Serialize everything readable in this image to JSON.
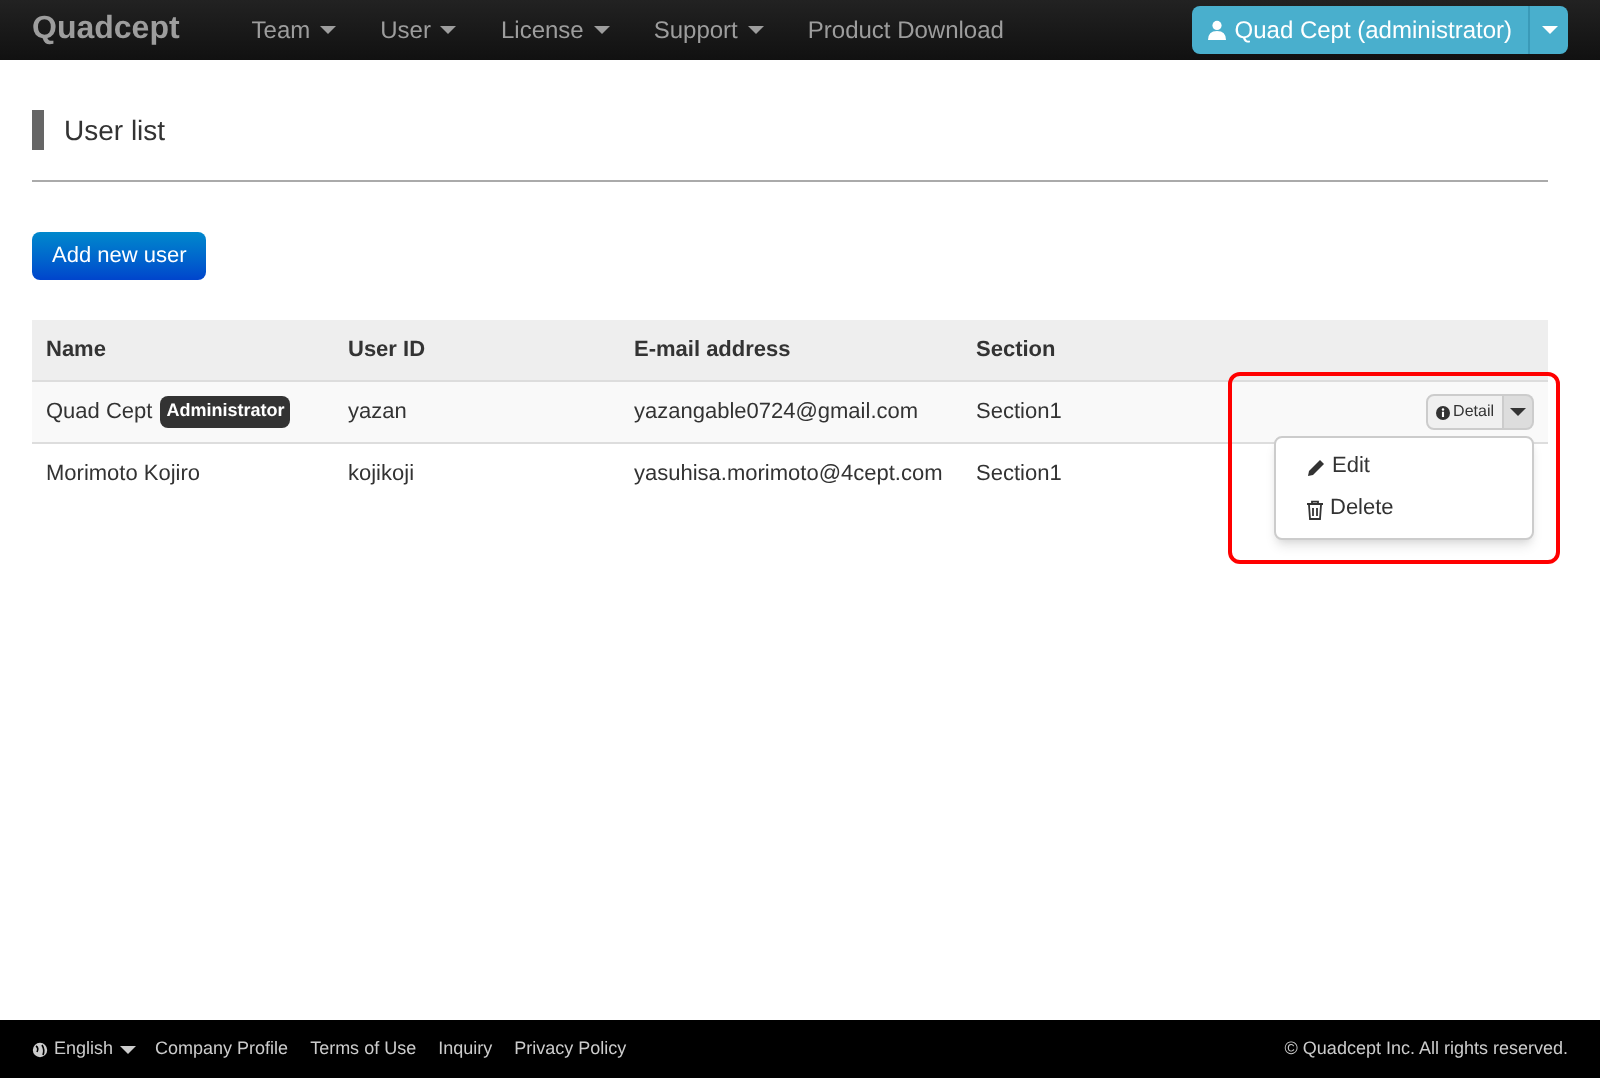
{
  "navbar": {
    "brand": "Quadcept",
    "items": [
      {
        "label": "Team",
        "dropdown": true
      },
      {
        "label": "User",
        "dropdown": true
      },
      {
        "label": "License",
        "dropdown": true
      },
      {
        "label": "Support",
        "dropdown": true
      },
      {
        "label": "Product Download",
        "dropdown": false
      }
    ],
    "account": "Quad Cept (administrator)"
  },
  "page_title": "User list",
  "add_button": "Add new user",
  "table": {
    "columns": [
      "Name",
      "User ID",
      "E-mail address",
      "Section"
    ],
    "rows": [
      {
        "name": "Quad Cept",
        "badge": "Administrator",
        "user_id": "yazan",
        "email": "yazangable0724@gmail.com",
        "section": "Section1",
        "detail": "Detail",
        "menu_open": true,
        "menu": [
          {
            "kind": "edit",
            "label": "Edit"
          },
          {
            "kind": "delete",
            "label": "Delete"
          }
        ]
      },
      {
        "name": "Morimoto Kojiro",
        "user_id": "kojikoji",
        "email": "yasuhisa.morimoto@4cept.com",
        "section": "Section1"
      }
    ]
  },
  "footer": {
    "language": "English",
    "links": [
      "Company Profile",
      "Terms of Use",
      "Inquiry",
      "Privacy Policy"
    ],
    "copyright": "© Quadcept Inc. All rights reserved."
  }
}
